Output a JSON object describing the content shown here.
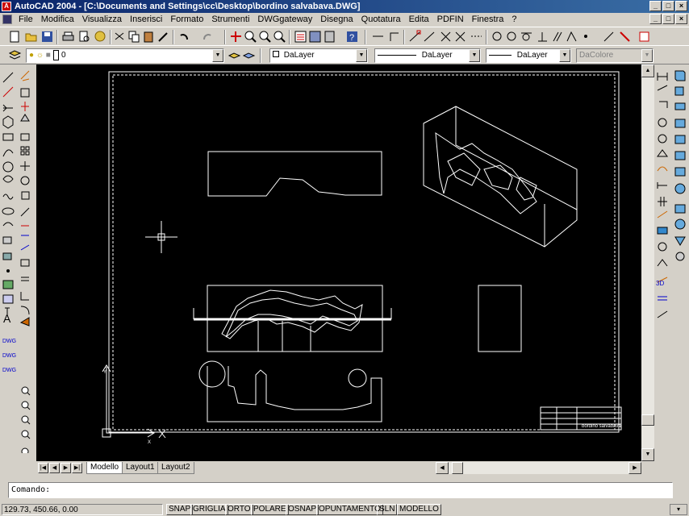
{
  "window": {
    "title": "AutoCAD 2004 - [C:\\Documents and Settings\\cc\\Desktop\\bordino salvabava.DWG]",
    "app_icon": "autocad-logo-icon",
    "controls": [
      "_",
      "□",
      "×"
    ]
  },
  "menu": {
    "items": [
      "File",
      "Modifica",
      "Visualizza",
      "Inserisci",
      "Formato",
      "Strumenti",
      "DWGgateway",
      "Disegna",
      "Quotatura",
      "Edita",
      "PDFIN",
      "Finestra",
      "?"
    ]
  },
  "layers": {
    "current_layer": "0",
    "color": "DaLayer",
    "linetype": "DaLayer",
    "lineweight": "DaLayer",
    "plotstyle": "DaColore"
  },
  "drawing": {
    "titleblock_text": "bordino salvabava"
  },
  "tabs": {
    "items": [
      "Modello",
      "Layout1",
      "Layout2"
    ],
    "active": "Modello"
  },
  "command": {
    "prompt": "Comando:"
  },
  "status": {
    "coords": "129.73, 450.66, 0.00",
    "toggles": [
      "SNAP",
      "GRIGLIA",
      "ORTO",
      "POLARE",
      "OSNAP",
      "OPUNTAMENTO",
      "SLN",
      "MODELLO"
    ]
  }
}
